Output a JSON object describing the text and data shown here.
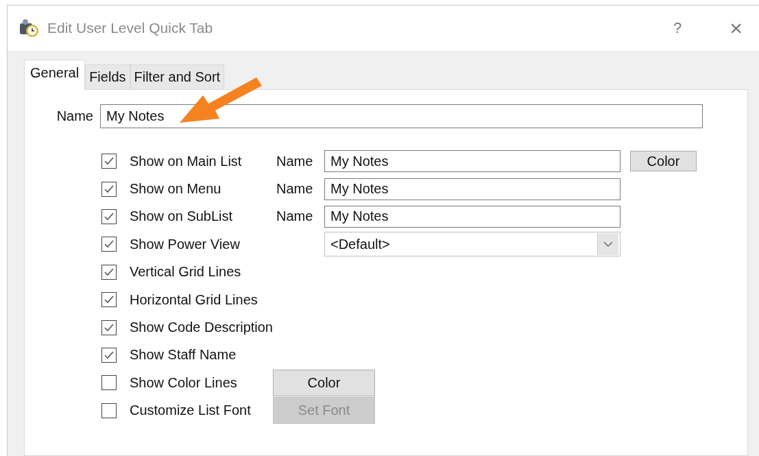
{
  "window": {
    "title": "Edit User Level Quick Tab",
    "help": "?",
    "close": "×"
  },
  "tabs": [
    {
      "label": "General",
      "selected": true
    },
    {
      "label": "Fields",
      "selected": false
    },
    {
      "label": "Filter and Sort",
      "selected": false
    }
  ],
  "name_field": {
    "label": "Name",
    "value": "My Notes"
  },
  "options": [
    {
      "kind": "named",
      "label": "Show on Main List",
      "checked": true,
      "name_label": "Name",
      "value": "My Notes",
      "button": {
        "label": "Color",
        "disabled": false
      }
    },
    {
      "kind": "named",
      "label": "Show on Menu",
      "checked": true,
      "name_label": "Name",
      "value": "My Notes"
    },
    {
      "kind": "named",
      "label": "Show on SubList",
      "checked": true,
      "name_label": "Name",
      "value": "My Notes"
    },
    {
      "kind": "combo",
      "label": "Show Power View",
      "checked": true,
      "value": "<Default>"
    },
    {
      "kind": "plain",
      "label": "Vertical Grid Lines",
      "checked": true
    },
    {
      "kind": "plain",
      "label": "Horizontal Grid Lines",
      "checked": true
    },
    {
      "kind": "plain",
      "label": "Show Code Description",
      "checked": true
    },
    {
      "kind": "plain",
      "label": "Show Staff Name",
      "checked": true
    },
    {
      "kind": "button",
      "label": "Show Color Lines",
      "checked": false,
      "button": {
        "label": "Color",
        "disabled": false
      }
    },
    {
      "kind": "button",
      "label": "Customize List Font",
      "checked": false,
      "button": {
        "label": "Set Font",
        "disabled": true
      }
    }
  ]
}
